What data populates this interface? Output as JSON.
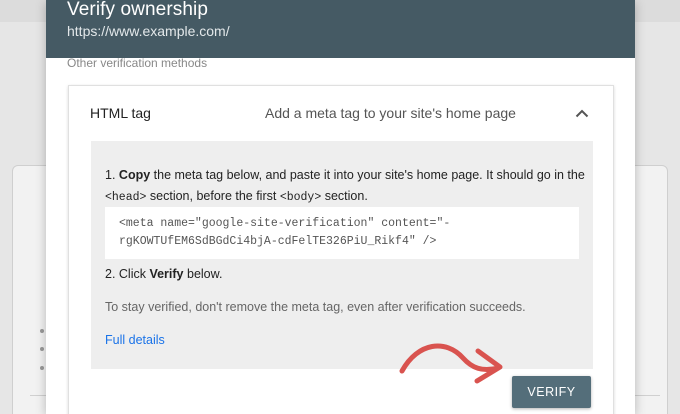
{
  "modal": {
    "title": "Verify ownership",
    "subtitle": "https://www.example.com/",
    "other_methods_label": "Other verification methods"
  },
  "panel": {
    "title": "HTML tag",
    "description": "Add a meta tag to your site's home page",
    "expanded": true,
    "icon": "chevron-up-icon"
  },
  "instructions": {
    "step1_number": "1.",
    "step1_bold": "Copy",
    "step1_text_a": " the meta tag below, and paste it into your site's home page. It should go in the ",
    "step1_code_head": "<head>",
    "step1_text_b": " section, before the first ",
    "step1_code_body": "<body>",
    "step1_text_c": " section.",
    "meta_tag_line1": "<meta name=\"google-site-verification\" content=\"-",
    "meta_tag_line2": "rgKOWTUfEM6SdBGdCi4bjA-cdFelTE326PiU_Rikf4\" />",
    "step2_prefix": "2. Click ",
    "step2_bold": "Verify",
    "step2_suffix": " below.",
    "note": "To stay verified, don't remove the meta tag, even after verification succeeds.",
    "full_details_link": "Full details"
  },
  "actions": {
    "verify_label": "VERIFY"
  },
  "colors": {
    "header_bg": "#455a64",
    "button_bg": "#546e7a",
    "link": "#1a73e8",
    "annotation_arrow": "#d9534f"
  }
}
